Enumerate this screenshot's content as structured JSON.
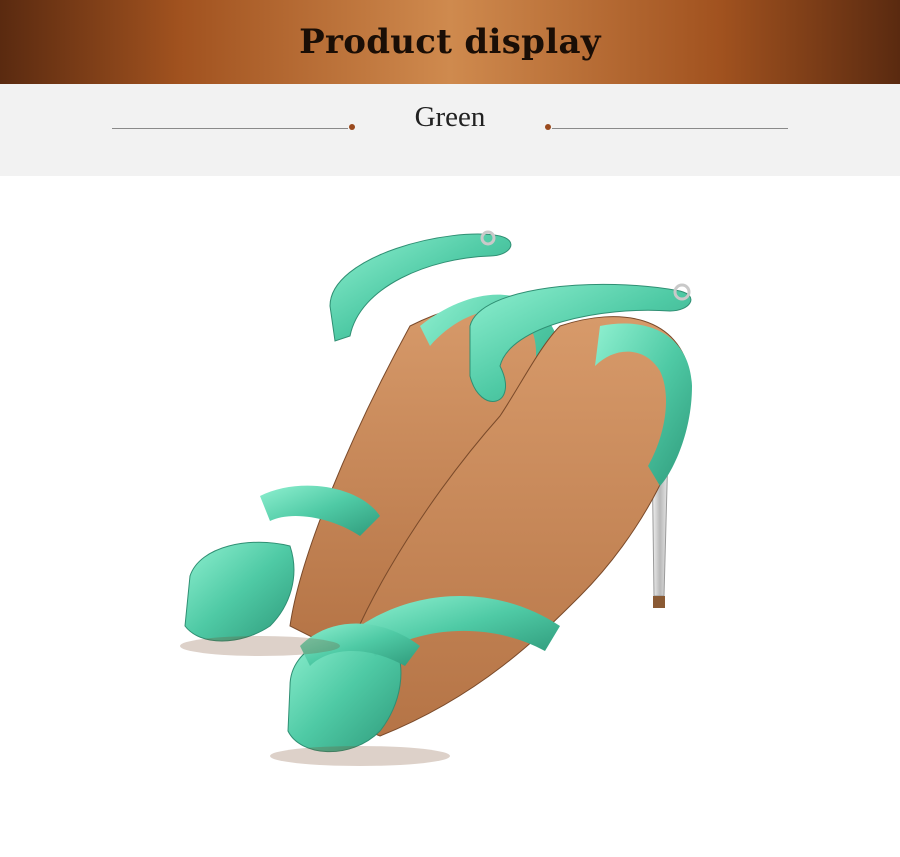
{
  "banner": {
    "title": "Product display"
  },
  "section": {
    "color_label": "Green"
  },
  "product_image": {
    "subject": "green-ankle-strap-sandals",
    "colors": {
      "leather": "#5fd3b1",
      "lining": "#c98a5c",
      "heel": "#d9d9d9",
      "banner": "#a1521f"
    }
  }
}
